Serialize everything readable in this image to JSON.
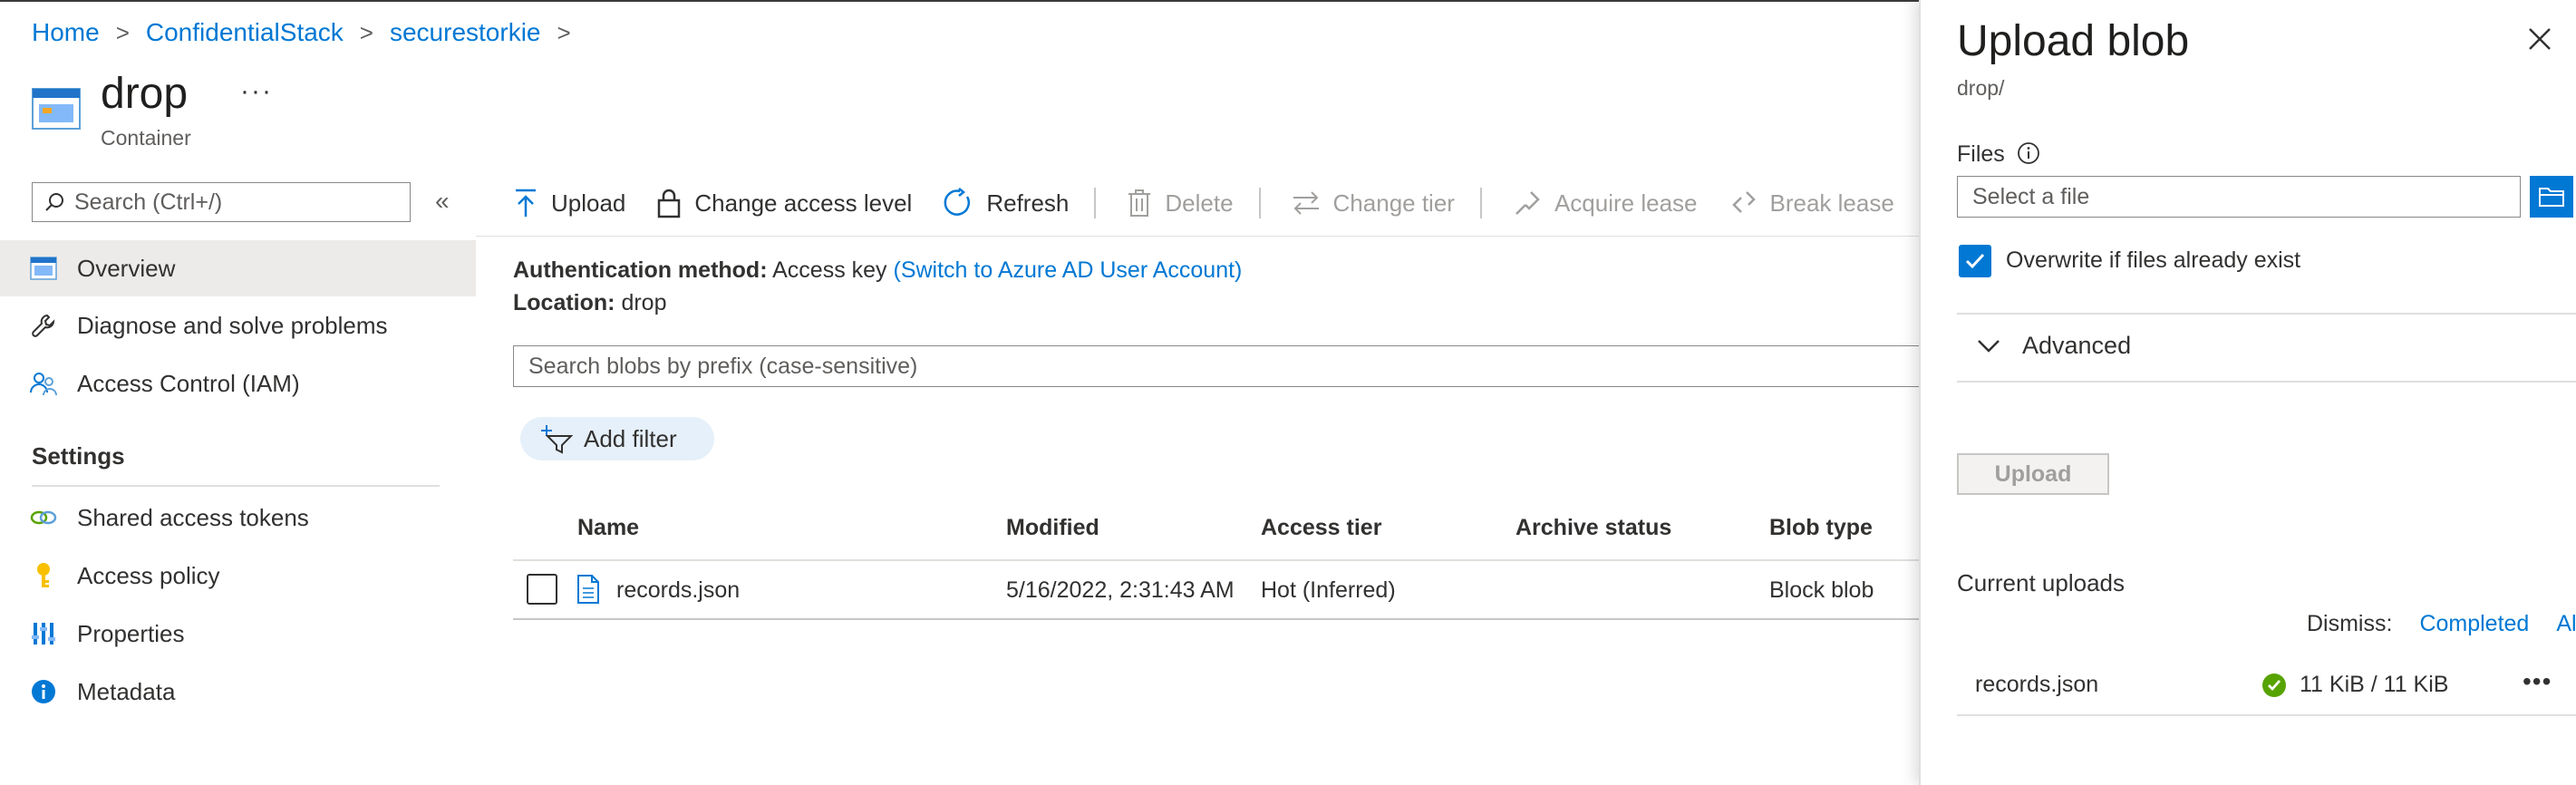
{
  "breadcrumb": {
    "items": [
      "Home",
      "ConfidentialStack",
      "securestorkie"
    ],
    "separator": ">"
  },
  "header": {
    "title": "drop",
    "subtitle": "Container",
    "more": "···"
  },
  "sidebar": {
    "search_placeholder": "Search (Ctrl+/)",
    "collapse": "«",
    "items": [
      {
        "label": "Overview",
        "icon": "container-icon",
        "active": true
      },
      {
        "label": "Diagnose and solve problems",
        "icon": "wrench-icon"
      },
      {
        "label": "Access Control (IAM)",
        "icon": "people-icon"
      }
    ],
    "settings_heading": "Settings",
    "settings_items": [
      {
        "label": "Shared access tokens",
        "icon": "link-icon"
      },
      {
        "label": "Access policy",
        "icon": "key-icon"
      },
      {
        "label": "Properties",
        "icon": "properties-icon"
      },
      {
        "label": "Metadata",
        "icon": "info-icon"
      }
    ]
  },
  "toolbar": {
    "upload": "Upload",
    "change_access": "Change access level",
    "refresh": "Refresh",
    "delete": "Delete",
    "change_tier": "Change tier",
    "acquire_lease": "Acquire lease",
    "break_lease": "Break lease"
  },
  "info": {
    "auth_label": "Authentication method:",
    "auth_value": "Access key",
    "auth_link": "(Switch to Azure AD User Account)",
    "location_label": "Location:",
    "location_value": "drop"
  },
  "blob_search_placeholder": "Search blobs by prefix (case-sensitive)",
  "add_filter": "Add filter",
  "table": {
    "columns": [
      "Name",
      "Modified",
      "Access tier",
      "Archive status",
      "Blob type"
    ],
    "rows": [
      {
        "name": "records.json",
        "modified": "5/16/2022, 2:31:43 AM",
        "access_tier": "Hot (Inferred)",
        "archive_status": "",
        "blob_type": "Block blob"
      }
    ]
  },
  "panel": {
    "title": "Upload blob",
    "subtitle": "drop/",
    "files_label": "Files",
    "file_placeholder": "Select a file",
    "overwrite_label": "Overwrite if files already exist",
    "advanced": "Advanced",
    "upload_button": "Upload",
    "current_uploads": "Current uploads",
    "dismiss_label": "Dismiss:",
    "dismiss_completed": "Completed",
    "dismiss_all": "All",
    "upload_item": {
      "name": "records.json",
      "progress": "11 KiB / 11 KiB",
      "status": "completed"
    },
    "more": "•••"
  },
  "colors": {
    "accent": "#0078d4",
    "success": "#57a300",
    "active_bg": "#edebe9"
  }
}
